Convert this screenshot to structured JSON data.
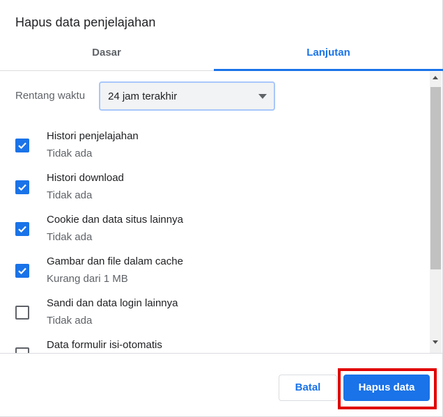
{
  "dialog": {
    "title": "Hapus data penjelajahan"
  },
  "tabs": [
    {
      "label": "Dasar",
      "active": false
    },
    {
      "label": "Lanjutan",
      "active": true
    }
  ],
  "time_range": {
    "label": "Rentang waktu",
    "selected": "24 jam terakhir"
  },
  "options": [
    {
      "label": "Histori penjelajahan",
      "detail": "Tidak ada",
      "checked": true
    },
    {
      "label": "Histori download",
      "detail": "Tidak ada",
      "checked": true
    },
    {
      "label": "Cookie dan data situs lainnya",
      "detail": "Tidak ada",
      "checked": true
    },
    {
      "label": "Gambar dan file dalam cache",
      "detail": "Kurang dari 1 MB",
      "checked": true
    },
    {
      "label": "Sandi dan data login lainnya",
      "detail": "Tidak ada",
      "checked": false
    },
    {
      "label": "Data formulir isi-otomatis",
      "detail": "",
      "checked": false
    }
  ],
  "footer": {
    "cancel_label": "Batal",
    "confirm_label": "Hapus data"
  },
  "colors": {
    "accent": "#1a73e8",
    "highlight": "#e00000"
  }
}
